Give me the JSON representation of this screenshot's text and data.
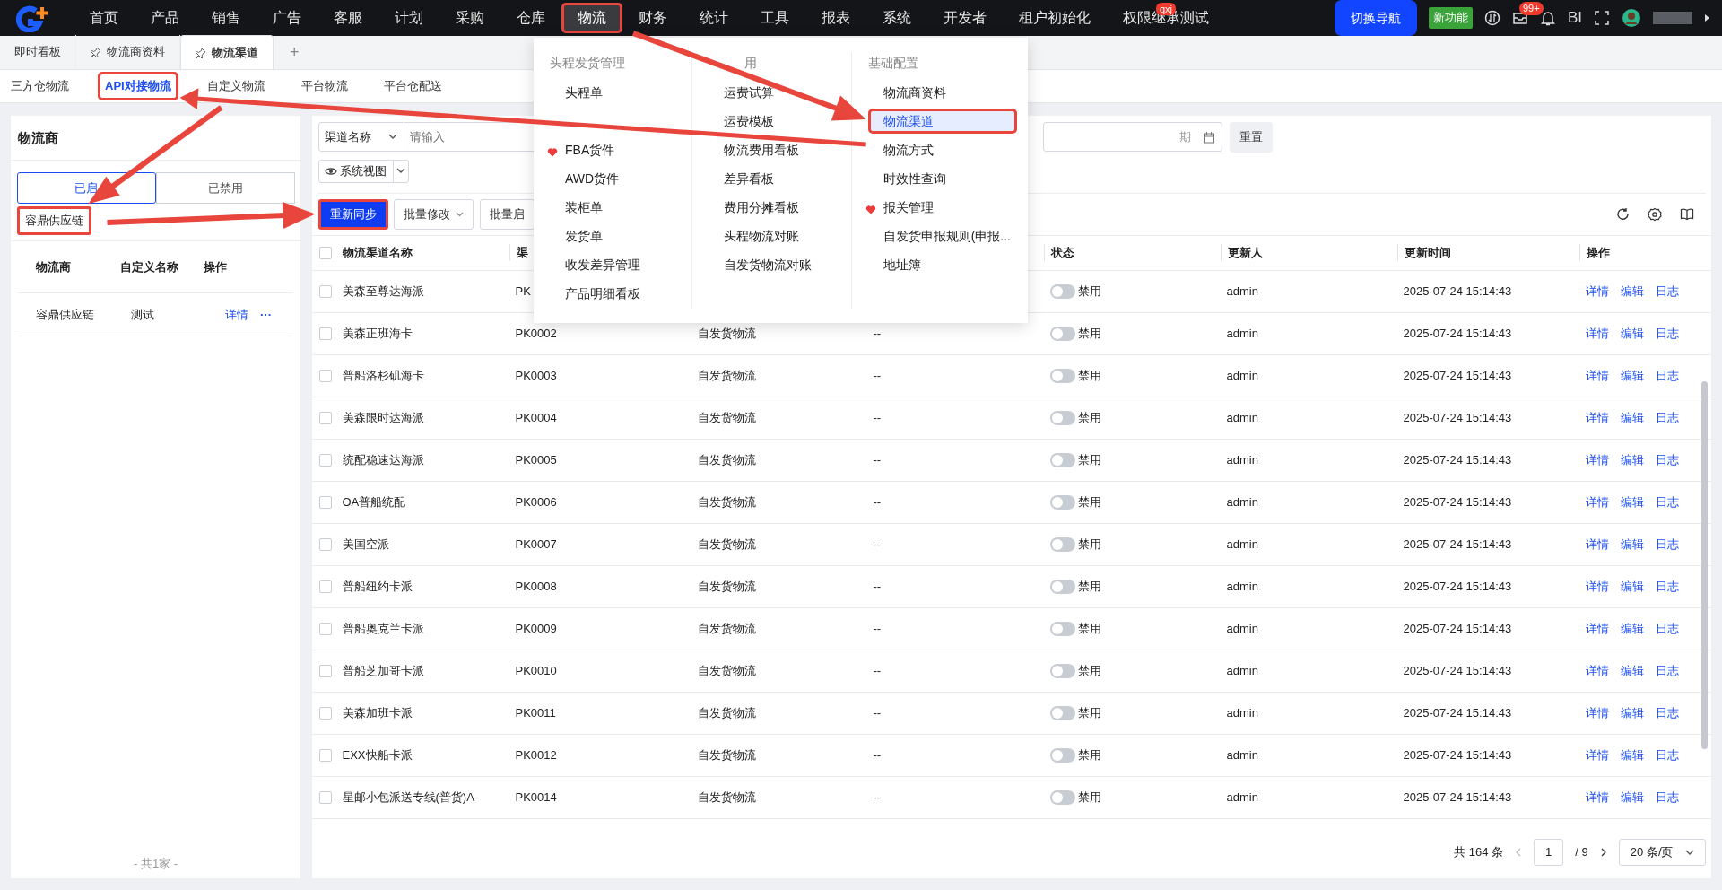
{
  "top_nav": {
    "items": [
      {
        "label": "首页",
        "selected": false,
        "highlighted": false
      },
      {
        "label": "产品",
        "selected": false,
        "highlighted": false
      },
      {
        "label": "销售",
        "selected": false,
        "highlighted": false
      },
      {
        "label": "广告",
        "selected": false,
        "highlighted": false
      },
      {
        "label": "客服",
        "selected": false,
        "highlighted": false
      },
      {
        "label": "计划",
        "selected": false,
        "highlighted": false
      },
      {
        "label": "采购",
        "selected": false,
        "highlighted": false
      },
      {
        "label": "仓库",
        "selected": false,
        "highlighted": false
      },
      {
        "label": "物流",
        "selected": true,
        "highlighted": true
      },
      {
        "label": "财务",
        "selected": false,
        "highlighted": false
      },
      {
        "label": "统计",
        "selected": false,
        "highlighted": false
      },
      {
        "label": "工具",
        "selected": false,
        "highlighted": false
      },
      {
        "label": "报表",
        "selected": false,
        "highlighted": false
      },
      {
        "label": "系统",
        "selected": false,
        "highlighted": false
      },
      {
        "label": "开发者",
        "selected": false,
        "highlighted": false
      },
      {
        "label": "租户初始化",
        "selected": false,
        "highlighted": false
      },
      {
        "label": "权限继承测试",
        "selected": false,
        "highlighted": false,
        "badge": "qxj"
      }
    ],
    "switch_nav": "切换导航",
    "new_feature": "新功能",
    "inbox_badge": "99+",
    "bi": "BI"
  },
  "page_tabs": {
    "items": [
      {
        "label": "即时看板",
        "pinned": false,
        "selected": false
      },
      {
        "label": "物流商资料",
        "pinned": true,
        "selected": false
      },
      {
        "label": "物流渠道",
        "pinned": true,
        "selected": true
      }
    ],
    "add": "+"
  },
  "sub_tabs": [
    {
      "label": "三方仓物流",
      "selected": false,
      "highlighted": false
    },
    {
      "label": "API对接物流",
      "selected": true,
      "highlighted": true
    },
    {
      "label": "自定义物流",
      "selected": false,
      "highlighted": false
    },
    {
      "label": "平台物流",
      "selected": false,
      "highlighted": false
    },
    {
      "label": "平台仓配送",
      "selected": false,
      "highlighted": false
    }
  ],
  "menu": {
    "columns": [
      {
        "heading": "头程发货管理",
        "items": [
          {
            "kind": "entry",
            "label": "头程单",
            "favorite": false,
            "selected": false,
            "highlighted": false
          },
          {
            "kind": "covered"
          },
          {
            "kind": "entry",
            "label": "FBA货件",
            "favorite": true,
            "selected": false,
            "highlighted": false
          },
          {
            "kind": "entry",
            "label": "AWD货件",
            "favorite": false,
            "selected": false,
            "highlighted": false
          },
          {
            "kind": "entry",
            "label": "装柜单",
            "favorite": false,
            "selected": false,
            "highlighted": false
          },
          {
            "kind": "entry",
            "label": "发货单",
            "favorite": false,
            "selected": false,
            "highlighted": false
          },
          {
            "kind": "entry",
            "label": "收发差异管理",
            "favorite": false,
            "selected": false,
            "highlighted": false
          },
          {
            "kind": "entry",
            "label": "产品明细看板",
            "favorite": false,
            "selected": false,
            "highlighted": false
          }
        ]
      },
      {
        "heading": "用",
        "items": [
          {
            "kind": "entry",
            "label": "运费试算",
            "favorite": false,
            "selected": false,
            "highlighted": false
          },
          {
            "kind": "entry",
            "label": "运费模板",
            "favorite": false,
            "selected": false,
            "highlighted": false
          },
          {
            "kind": "entry",
            "label": "物流费用看板",
            "favorite": false,
            "selected": false,
            "highlighted": false
          },
          {
            "kind": "entry",
            "label": "差异看板",
            "favorite": false,
            "selected": false,
            "highlighted": false
          },
          {
            "kind": "entry",
            "label": "费用分摊看板",
            "favorite": false,
            "selected": false,
            "highlighted": false
          },
          {
            "kind": "entry",
            "label": "头程物流对账",
            "favorite": false,
            "selected": false,
            "highlighted": false
          },
          {
            "kind": "entry",
            "label": "自发货物流对账",
            "favorite": false,
            "selected": false,
            "highlighted": false
          }
        ]
      },
      {
        "heading": "基础配置",
        "items": [
          {
            "kind": "entry",
            "label": "物流商资料",
            "favorite": false,
            "selected": false,
            "highlighted": false
          },
          {
            "kind": "entry",
            "label": "物流渠道",
            "favorite": false,
            "selected": true,
            "highlighted": true
          },
          {
            "kind": "entry",
            "label": "物流方式",
            "favorite": false,
            "selected": false,
            "highlighted": false
          },
          {
            "kind": "entry",
            "label": "时效性查询",
            "favorite": false,
            "selected": false,
            "highlighted": false
          },
          {
            "kind": "entry",
            "label": "报关管理",
            "favorite": true,
            "selected": false,
            "highlighted": false
          },
          {
            "kind": "entry",
            "label": "自发货申报规则(申报...",
            "favorite": false,
            "selected": false,
            "highlighted": false
          },
          {
            "kind": "entry",
            "label": "地址簿",
            "favorite": false,
            "selected": false,
            "highlighted": false
          }
        ]
      }
    ]
  },
  "left_panel": {
    "title": "物流商",
    "segments": [
      {
        "label": "已启",
        "selected": true
      },
      {
        "label": "已禁用",
        "selected": false
      }
    ],
    "tag": {
      "label": "容鼎供应链",
      "highlighted": true
    },
    "columns": [
      "物流商",
      "自定义名称",
      "操作"
    ],
    "rows": [
      {
        "provider": "容鼎供应链",
        "custom_name": "测试",
        "action": "详情",
        "more": "···"
      }
    ],
    "footer": "- 共1家 -"
  },
  "filters": {
    "field_select": "渠道名称",
    "placeholder": "请输入",
    "date_placeholder": "期",
    "reset": "重置",
    "view": "系统视图"
  },
  "toolbar": [
    {
      "label": "重新同步",
      "kind": "primary",
      "highlighted": true
    },
    {
      "label": "批量修改",
      "kind": "dropdown",
      "highlighted": false
    },
    {
      "label": "批量启",
      "kind": "plain",
      "highlighted": false
    }
  ],
  "table": {
    "all_checked": false,
    "columns": [
      "物流渠道名称",
      "渠",
      "状态",
      "更新人",
      "更新时间",
      "操作"
    ],
    "rows": [
      {
        "name": "美森至尊达海派",
        "code": "PK",
        "status": "禁用",
        "on": false,
        "checked": false,
        "updater": "admin",
        "time": "2025-07-24 15:14:43",
        "actions": [
          "详情",
          "编辑",
          "日志"
        ]
      },
      {
        "name": "美森正班海卡",
        "code": "PK0002",
        "type": "自发货物流",
        "remark": "--",
        "status": "禁用",
        "on": false,
        "checked": false,
        "updater": "admin",
        "time": "2025-07-24 15:14:43",
        "actions": [
          "详情",
          "编辑",
          "日志"
        ]
      },
      {
        "name": "普船洛杉矶海卡",
        "code": "PK0003",
        "type": "自发货物流",
        "remark": "--",
        "status": "禁用",
        "on": false,
        "checked": false,
        "updater": "admin",
        "time": "2025-07-24 15:14:43",
        "actions": [
          "详情",
          "编辑",
          "日志"
        ]
      },
      {
        "name": "美森限时达海派",
        "code": "PK0004",
        "type": "自发货物流",
        "remark": "--",
        "status": "禁用",
        "on": false,
        "checked": false,
        "updater": "admin",
        "time": "2025-07-24 15:14:43",
        "actions": [
          "详情",
          "编辑",
          "日志"
        ]
      },
      {
        "name": "统配稳速达海派",
        "code": "PK0005",
        "type": "自发货物流",
        "remark": "--",
        "status": "禁用",
        "on": false,
        "checked": false,
        "updater": "admin",
        "time": "2025-07-24 15:14:43",
        "actions": [
          "详情",
          "编辑",
          "日志"
        ]
      },
      {
        "name": "OA普船统配",
        "code": "PK0006",
        "type": "自发货物流",
        "remark": "--",
        "status": "禁用",
        "on": false,
        "checked": false,
        "updater": "admin",
        "time": "2025-07-24 15:14:43",
        "actions": [
          "详情",
          "编辑",
          "日志"
        ]
      },
      {
        "name": "美国空派",
        "code": "PK0007",
        "type": "自发货物流",
        "remark": "--",
        "status": "禁用",
        "on": false,
        "checked": false,
        "updater": "admin",
        "time": "2025-07-24 15:14:43",
        "actions": [
          "详情",
          "编辑",
          "日志"
        ]
      },
      {
        "name": "普船纽约卡派",
        "code": "PK0008",
        "type": "自发货物流",
        "remark": "--",
        "status": "禁用",
        "on": false,
        "checked": false,
        "updater": "admin",
        "time": "2025-07-24 15:14:43",
        "actions": [
          "详情",
          "编辑",
          "日志"
        ]
      },
      {
        "name": "普船奥克兰卡派",
        "code": "PK0009",
        "type": "自发货物流",
        "remark": "--",
        "status": "禁用",
        "on": false,
        "checked": false,
        "updater": "admin",
        "time": "2025-07-24 15:14:43",
        "actions": [
          "详情",
          "编辑",
          "日志"
        ]
      },
      {
        "name": "普船芝加哥卡派",
        "code": "PK0010",
        "type": "自发货物流",
        "remark": "--",
        "status": "禁用",
        "on": false,
        "checked": false,
        "updater": "admin",
        "time": "2025-07-24 15:14:43",
        "actions": [
          "详情",
          "编辑",
          "日志"
        ]
      },
      {
        "name": "美森加班卡派",
        "code": "PK0011",
        "type": "自发货物流",
        "remark": "--",
        "status": "禁用",
        "on": false,
        "checked": false,
        "updater": "admin",
        "time": "2025-07-24 15:14:43",
        "actions": [
          "详情",
          "编辑",
          "日志"
        ]
      },
      {
        "name": "EXX快船卡派",
        "code": "PK0012",
        "type": "自发货物流",
        "remark": "--",
        "status": "禁用",
        "on": false,
        "checked": false,
        "updater": "admin",
        "time": "2025-07-24 15:14:43",
        "actions": [
          "详情",
          "编辑",
          "日志"
        ]
      },
      {
        "name": "星邮小包派送专线(普货)A",
        "code": "PK0014",
        "type": "自发货物流",
        "remark": "--",
        "status": "禁用",
        "on": false,
        "checked": false,
        "updater": "admin",
        "time": "2025-07-24 15:14:43",
        "actions": [
          "详情",
          "编辑",
          "日志"
        ]
      }
    ]
  },
  "pagination": {
    "total": "共 164 条",
    "page": "1",
    "pages": "/ 9",
    "page_size": "20 条/页"
  }
}
